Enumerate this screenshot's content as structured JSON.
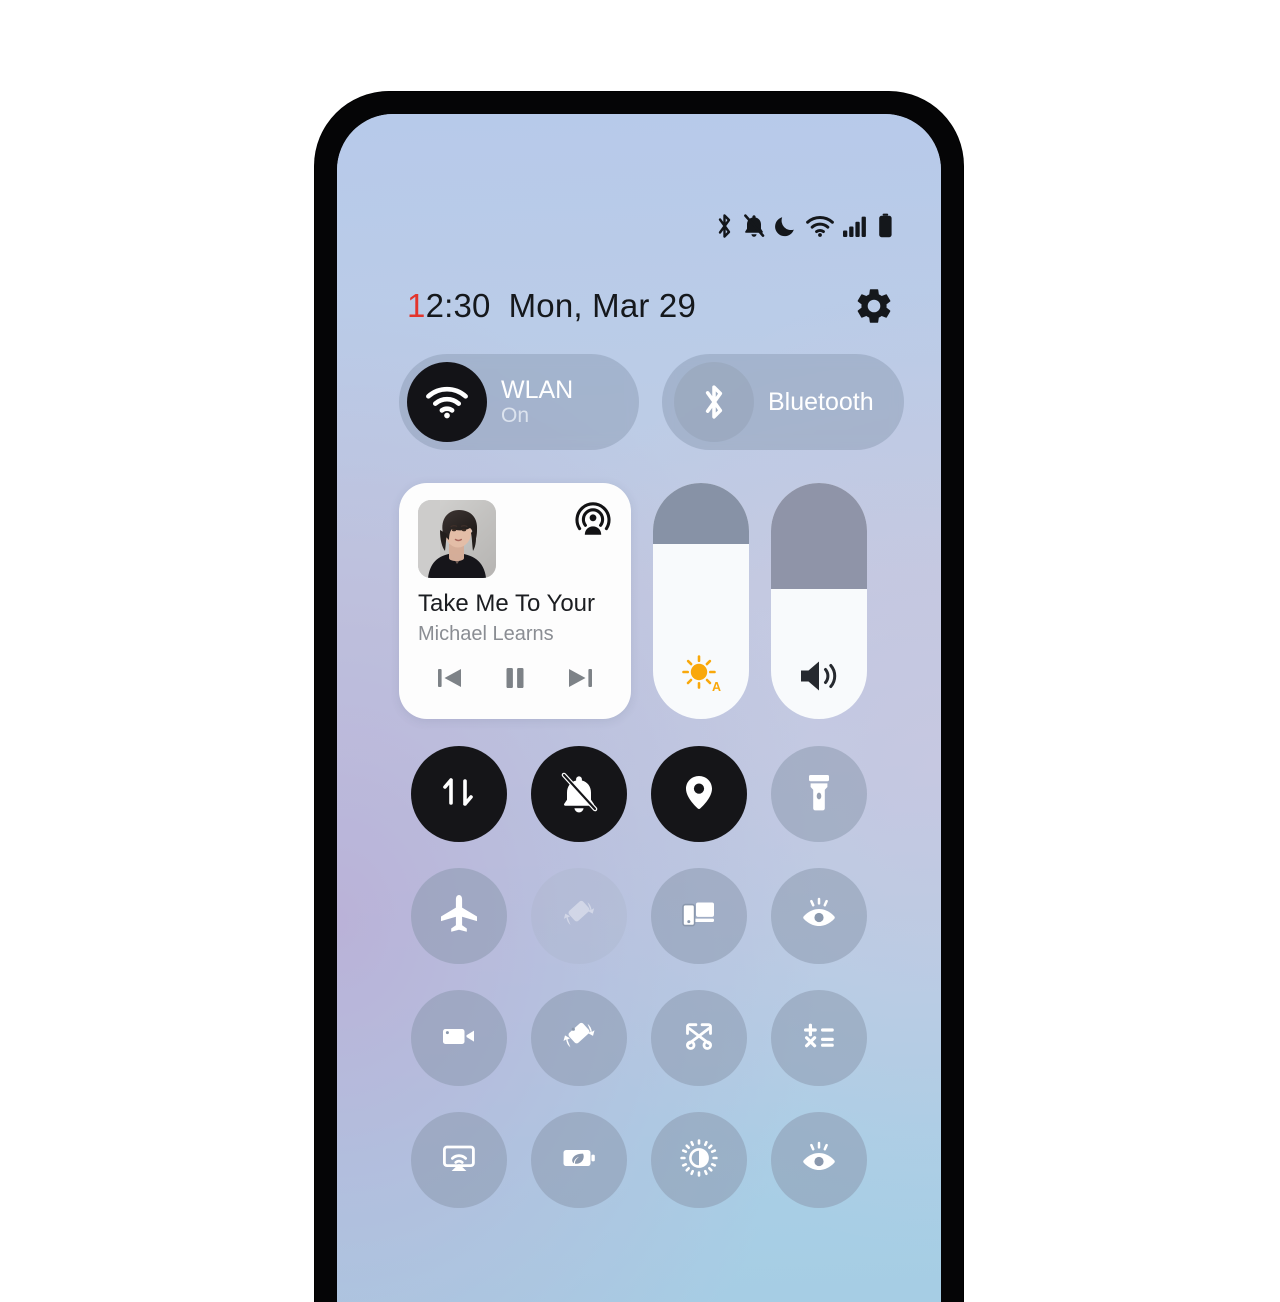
{
  "device": {
    "frame_color": "#050506",
    "wallpaper_colors": [
      "#b7caea",
      "#c1cbe2",
      "#a6cde4",
      "#baaed6"
    ]
  },
  "status_bar": {
    "icons": [
      {
        "name": "bluetooth-icon",
        "label": "Bluetooth"
      },
      {
        "name": "bell-off-icon",
        "label": "Silent"
      },
      {
        "name": "moon-icon",
        "label": "Do Not Disturb"
      },
      {
        "name": "wifi-icon",
        "label": "Wi-Fi"
      },
      {
        "name": "signal-bars-icon",
        "label": "Signal"
      },
      {
        "name": "battery-icon",
        "label": "Battery"
      }
    ],
    "icon_color": "#14171b"
  },
  "header": {
    "time_accent": "1",
    "time_rest": "2:30",
    "time_full": "12:30",
    "date": "Mon, Mar 29",
    "accent_color": "#e3342c",
    "settings_icon": "gear-icon"
  },
  "quick_pills": [
    {
      "name": "wlan",
      "icon": "wifi-icon",
      "title": "WLAN",
      "subtitle": "On",
      "state": "on"
    },
    {
      "name": "bluetooth",
      "icon": "bluetooth-icon",
      "title": "Bluetooth",
      "subtitle": "",
      "state": "off"
    }
  ],
  "media_player": {
    "title": "Take Me To Your",
    "artist": "Michael Learns",
    "album_art_alt": "portrait of woman with dark bob hair",
    "cast_icon": "audio-output-icon",
    "controls": [
      {
        "name": "previous-track-button",
        "icon": "skip-previous-icon"
      },
      {
        "name": "pause-button",
        "icon": "pause-icon"
      },
      {
        "name": "next-track-button",
        "icon": "skip-next-icon"
      }
    ]
  },
  "sliders": [
    {
      "name": "brightness-slider",
      "icon": "brightness-auto-icon",
      "value_percent": 74,
      "auto_label": "A",
      "icon_color": "#f5a310",
      "fill_color": "#8792a6"
    },
    {
      "name": "volume-slider",
      "icon": "volume-icon",
      "value_percent": 55,
      "icon_color": "#2c3036",
      "fill_color": "#8f94a8"
    }
  ],
  "toggles": [
    {
      "name": "mobile-data-toggle",
      "icon": "data-transfer-icon",
      "state": "on"
    },
    {
      "name": "silent-mode-toggle",
      "icon": "bell-off-icon",
      "state": "on"
    },
    {
      "name": "location-toggle",
      "icon": "location-pin-icon",
      "state": "on"
    },
    {
      "name": "flashlight-toggle",
      "icon": "flashlight-icon",
      "state": "off"
    },
    {
      "name": "airplane-mode-toggle",
      "icon": "airplane-icon",
      "state": "off"
    },
    {
      "name": "auto-rotate-toggle",
      "icon": "auto-rotate-icon",
      "state": "disabled"
    },
    {
      "name": "multi-device-toggle",
      "icon": "multi-device-icon",
      "state": "off"
    },
    {
      "name": "eye-comfort-toggle",
      "icon": "eye-care-icon",
      "state": "off"
    },
    {
      "name": "screen-recorder-toggle",
      "icon": "camcorder-icon",
      "state": "off"
    },
    {
      "name": "screen-rotation-toggle",
      "icon": "rotate-device-icon",
      "state": "off"
    },
    {
      "name": "screenshot-toggle",
      "icon": "scissors-screenshot-icon",
      "state": "off"
    },
    {
      "name": "calculator-toggle",
      "icon": "calculator-icon",
      "state": "off"
    },
    {
      "name": "cast-screen-toggle",
      "icon": "screen-cast-icon",
      "state": "off"
    },
    {
      "name": "battery-saver-toggle",
      "icon": "battery-leaf-icon",
      "state": "off"
    },
    {
      "name": "auto-contrast-toggle",
      "icon": "sun-contrast-icon",
      "state": "off"
    },
    {
      "name": "eye-protection-toggle",
      "icon": "eye-care-icon",
      "state": "off"
    }
  ]
}
